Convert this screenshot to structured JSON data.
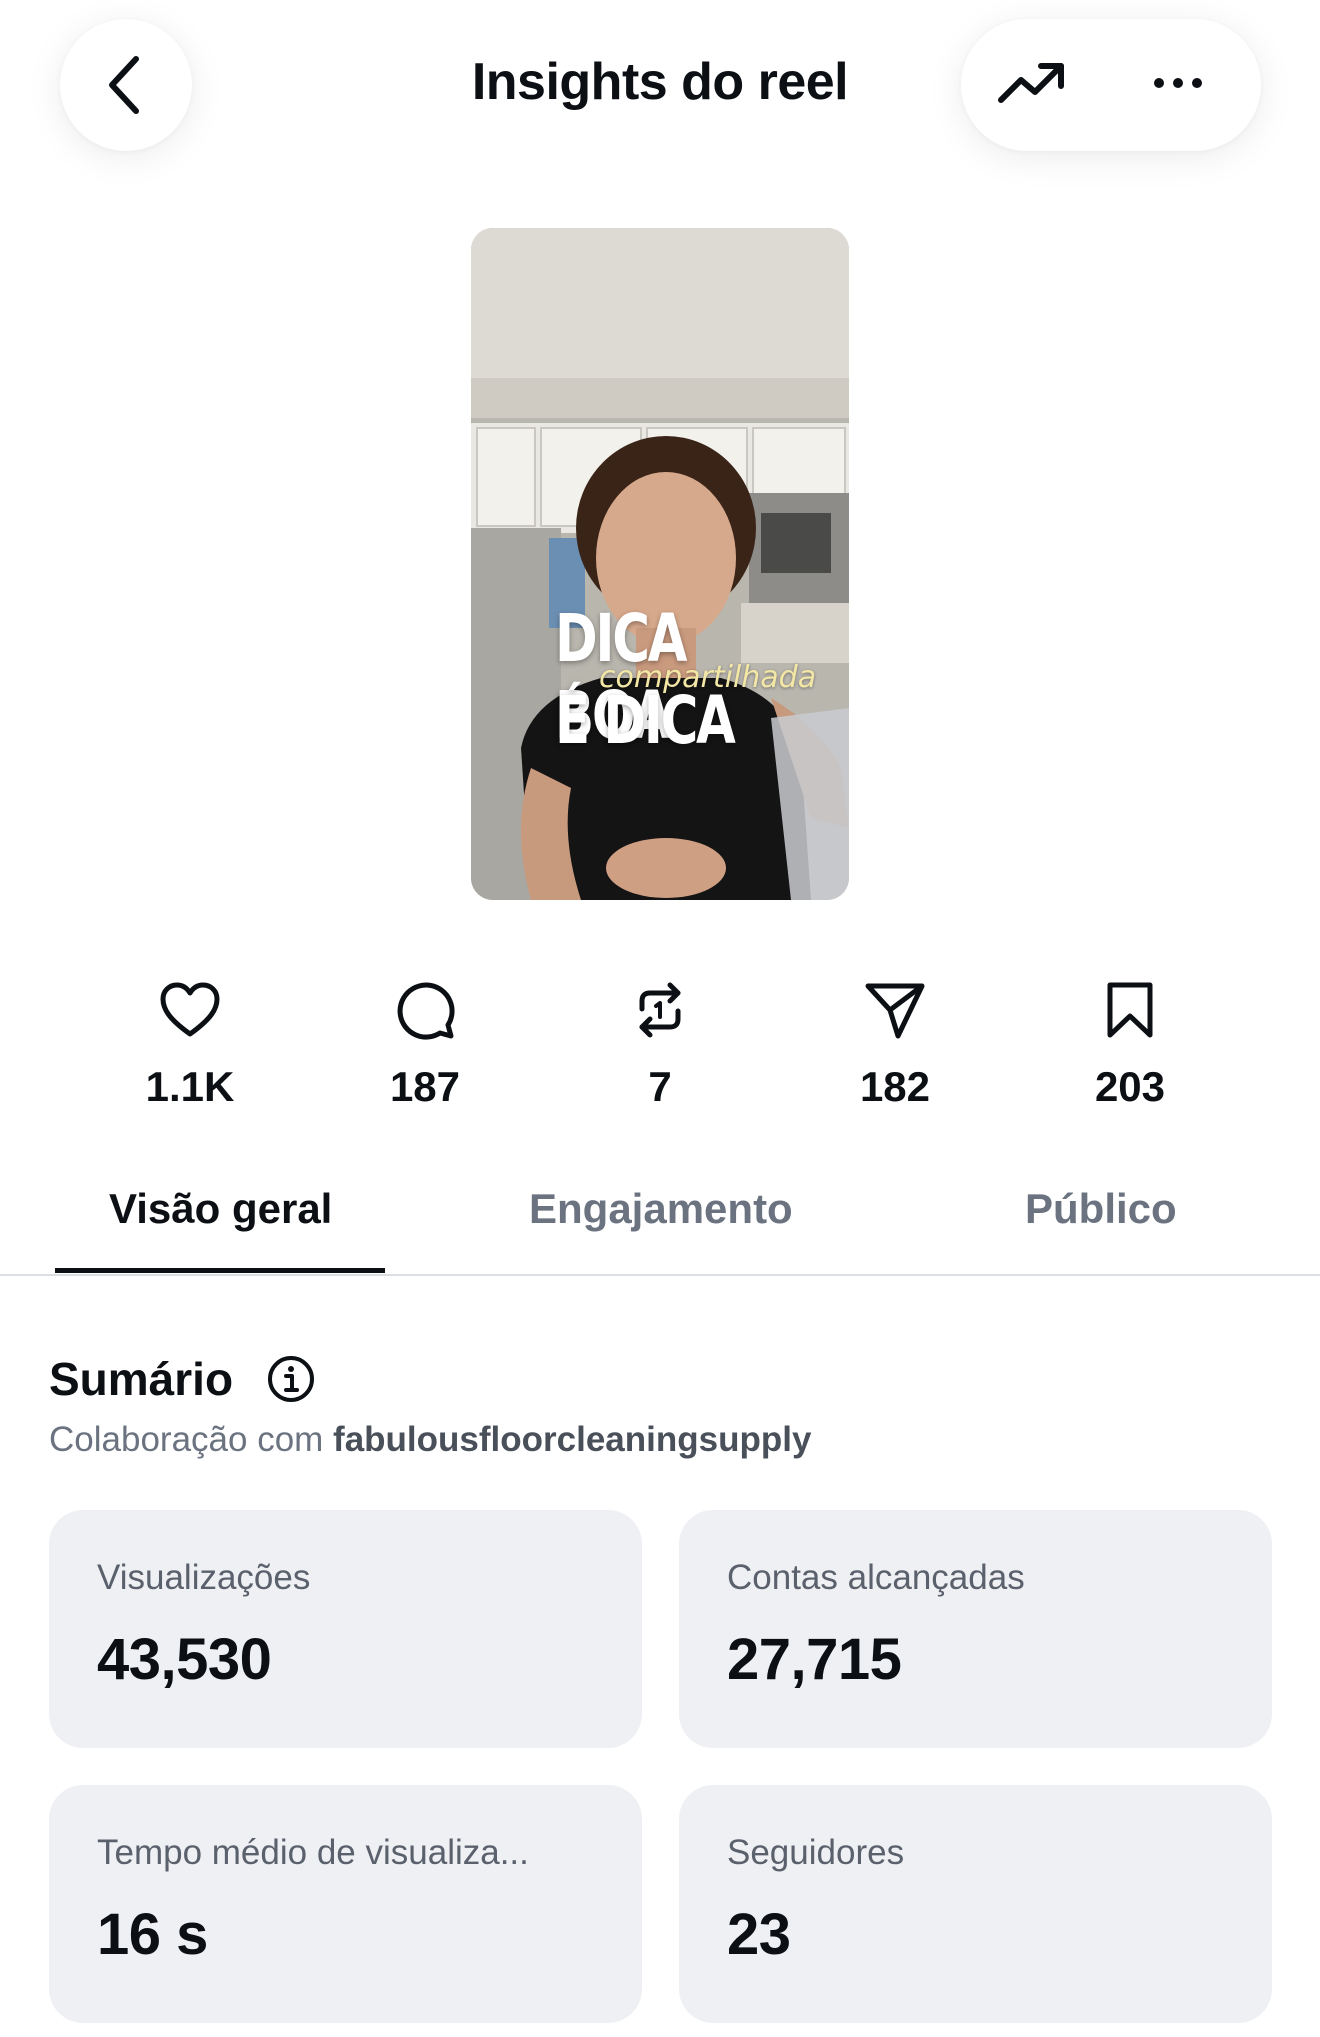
{
  "header": {
    "title": "Insights do reel",
    "back_icon": "chevron-left-icon",
    "trend_icon": "trending-up-icon",
    "more_icon": "more-horizontal-icon"
  },
  "reel": {
    "overlay_line1": "DICA BOA",
    "overlay_line2": "compartilhada",
    "overlay_line3": "É DICA"
  },
  "stats": [
    {
      "icon": "heart-icon",
      "value": "1.1K"
    },
    {
      "icon": "comment-icon",
      "value": "187"
    },
    {
      "icon": "repost-icon",
      "value": "7"
    },
    {
      "icon": "share-icon",
      "value": "182"
    },
    {
      "icon": "bookmark-icon",
      "value": "203"
    }
  ],
  "tabs": [
    {
      "label": "Visão geral",
      "active": true
    },
    {
      "label": "Engajamento",
      "active": false
    },
    {
      "label": "Público",
      "active": false
    }
  ],
  "summary": {
    "title": "Sumário",
    "subtitle_prefix": "Colaboração com",
    "collaborator": "fabulousfloorcleaningsupply",
    "cards": [
      {
        "label": "Visualizações",
        "value": "43,530"
      },
      {
        "label": "Contas alcançadas",
        "value": "27,715"
      },
      {
        "label": "Tempo médio de visualiza...",
        "value": "16 s"
      },
      {
        "label": "Seguidores",
        "value": "23"
      }
    ]
  },
  "colors": {
    "text": "#0c1014",
    "muted": "#6b7380",
    "card_bg": "#eff0f4",
    "divider": "#dbdee2"
  }
}
